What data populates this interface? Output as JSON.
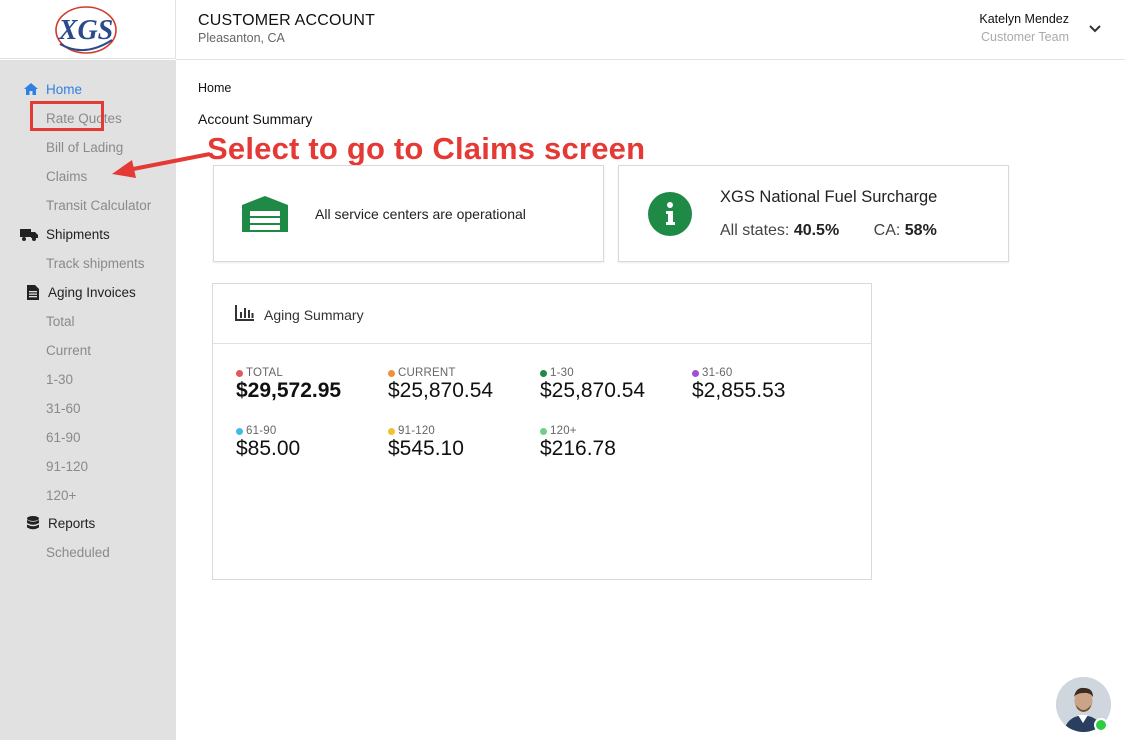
{
  "header": {
    "logo_text": "XGS",
    "title": "CUSTOMER ACCOUNT",
    "location": "Pleasanton, CA",
    "user_name": "Katelyn Mendez",
    "user_team": "Customer Team"
  },
  "sidebar": {
    "home": "Home",
    "home_items": [
      "Rate Quotes",
      "Bill of Lading",
      "Claims",
      "Transit Calculator"
    ],
    "shipments": "Shipments",
    "shipments_items": [
      "Track shipments"
    ],
    "aging": "Aging Invoices",
    "aging_items": [
      "Total",
      "Current",
      "1-30",
      "31-60",
      "61-90",
      "91-120",
      "120+"
    ],
    "reports": "Reports",
    "reports_items": [
      "Scheduled"
    ]
  },
  "annotation": {
    "text": "Select to go to Claims screen"
  },
  "main": {
    "breadcrumb": "Home",
    "title": "Account Summary",
    "status_text": "All service centers are operational",
    "fuel": {
      "title": "XGS National Fuel Surcharge",
      "all_states_label": "All states:",
      "all_states_value": "40.5%",
      "ca_label": "CA:",
      "ca_value": "58%"
    },
    "aging": {
      "title": "Aging Summary",
      "metrics": [
        {
          "label": "TOTAL",
          "value": "$29,572.95",
          "color": "#e05a5a"
        },
        {
          "label": "CURRENT",
          "value": "$25,870.54",
          "color": "#f0913a"
        },
        {
          "label": "1-30",
          "value": "$25,870.54",
          "color": "#1f8a45"
        },
        {
          "label": "31-60",
          "value": "$2,855.53",
          "color": "#a04fd6"
        },
        {
          "label": "61-90",
          "value": "$85.00",
          "color": "#3fbce8"
        },
        {
          "label": "91-120",
          "value": "$545.10",
          "color": "#f2c12e"
        },
        {
          "label": "120+",
          "value": "$216.78",
          "color": "#6fcf8a"
        }
      ]
    }
  },
  "colors": {
    "accent_blue": "#2f80e0",
    "annotation_red": "#e53935",
    "brand_green": "#1f8a45"
  }
}
